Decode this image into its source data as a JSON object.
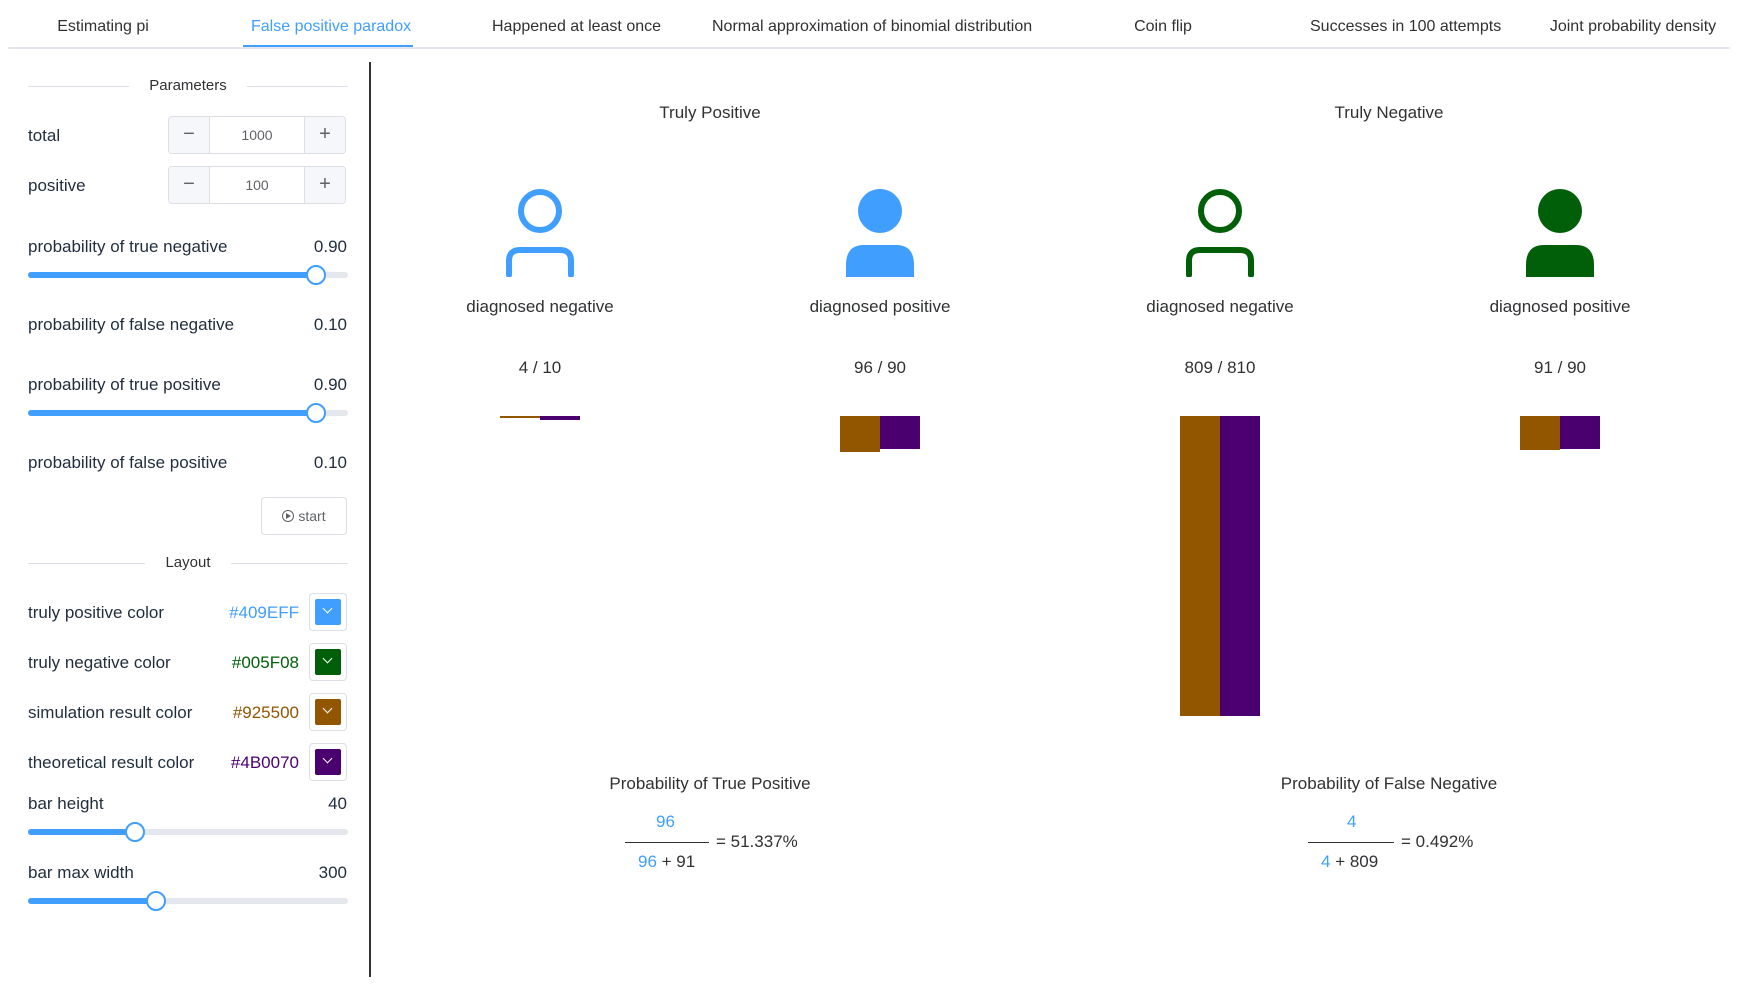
{
  "tabs": [
    {
      "label": "Estimating pi",
      "active": false
    },
    {
      "label": "False positive paradox",
      "active": true
    },
    {
      "label": "Happened at least once",
      "active": false
    },
    {
      "label": "Normal approximation of binomial distribution",
      "active": false
    },
    {
      "label": "Coin flip",
      "active": false
    },
    {
      "label": "Successes in 100 attempts",
      "active": false
    },
    {
      "label": "Joint probability density",
      "active": false
    }
  ],
  "parameters": {
    "heading": "Parameters",
    "total": {
      "label": "total",
      "value": "1000",
      "dec": "−",
      "inc": "+"
    },
    "positive": {
      "label": "positive",
      "value": "100",
      "dec": "−",
      "inc": "+"
    },
    "true_negative": {
      "label": "probability of true negative",
      "value": "0.90",
      "slider_fraction": 0.9
    },
    "false_negative": {
      "label": "probability of false negative",
      "value": "0.10"
    },
    "true_positive": {
      "label": "probability of true positive",
      "value": "0.90",
      "slider_fraction": 0.9
    },
    "false_positive": {
      "label": "probability of false positive",
      "value": "0.10"
    },
    "start_label": "start"
  },
  "layout": {
    "heading": "Layout",
    "truly_positive_color": {
      "label": "truly positive color",
      "value": "#409EFF"
    },
    "truly_negative_color": {
      "label": "truly negative color",
      "value": "#005F08"
    },
    "simulation_color": {
      "label": "simulation result color",
      "value": "#925500"
    },
    "theoretical_color": {
      "label": "theoretical result color",
      "value": "#4B0070"
    },
    "bar_height": {
      "label": "bar height",
      "value": "40",
      "slider_fraction": 0.333
    },
    "bar_max_width": {
      "label": "bar max width",
      "value": "300",
      "slider_fraction": 0.4
    }
  },
  "main": {
    "truly_positive_title": "Truly Positive",
    "truly_negative_title": "Truly Negative",
    "groups": [
      {
        "label": "diagnosed negative",
        "count": "4 / 10",
        "simulated": 4,
        "theoretical": 10,
        "filled": false,
        "truth": "positive"
      },
      {
        "label": "diagnosed positive",
        "count": "96 / 90",
        "simulated": 96,
        "theoretical": 90,
        "filled": true,
        "truth": "positive"
      },
      {
        "label": "diagnosed negative",
        "count": "809 / 810",
        "simulated": 809,
        "theoretical": 810,
        "filled": false,
        "truth": "negative"
      },
      {
        "label": "diagnosed positive",
        "count": "91 / 90",
        "simulated": 91,
        "theoretical": 90,
        "filled": true,
        "truth": "negative"
      }
    ],
    "formula_tp": {
      "title": "Probability of True Positive",
      "numerator": "96",
      "denom_a": "96",
      "denom_rest": "+ 91",
      "result": "= 51.337%"
    },
    "formula_fn": {
      "title": "Probability of False Negative",
      "numerator": "4",
      "denom_a": "4",
      "denom_rest": "+ 809",
      "result": "= 0.492%"
    }
  }
}
